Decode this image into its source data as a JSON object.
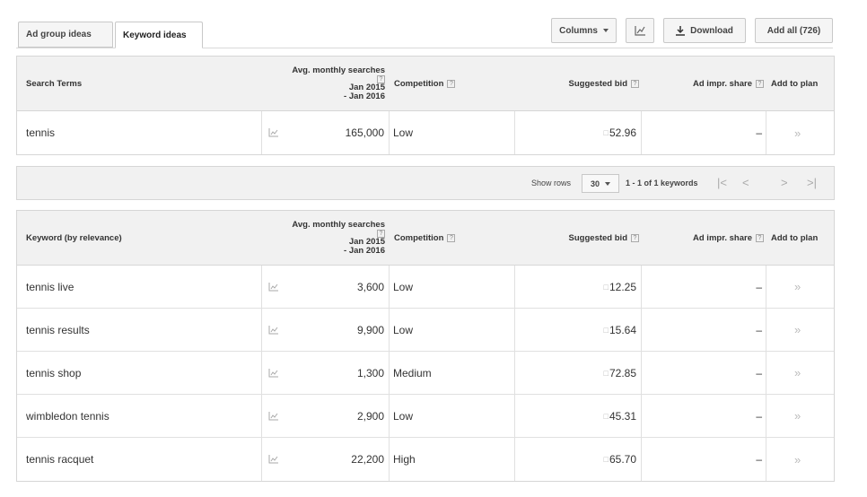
{
  "tabs": {
    "ad_group_ideas": "Ad group ideas",
    "keyword_ideas": "Keyword ideas"
  },
  "toolbar": {
    "columns_label": "Columns",
    "download_label": "Download",
    "add_all_label": "Add all (726)"
  },
  "search_terms_table": {
    "headers": {
      "term": "Search Terms",
      "searches_line1": "Avg. monthly searches",
      "searches_line2": "Jan 2015",
      "searches_line3": "- Jan 2016",
      "competition": "Competition",
      "bid": "Suggested bid",
      "impr_share": "Ad impr. share",
      "add_to_plan": "Add to plan"
    },
    "rows": [
      {
        "term": "tennis",
        "searches": "165,000",
        "competition": "Low",
        "bid": "52.96",
        "impr_share": "–",
        "add": "»"
      }
    ]
  },
  "pager": {
    "show_rows_label": "Show rows",
    "rows_value": "30",
    "range_text": "1 - 1 of 1 keywords",
    "first": "|<",
    "prev": "<",
    "next": ">",
    "last": ">|"
  },
  "keyword_table": {
    "headers": {
      "term": "Keyword (by relevance)",
      "searches_line1": "Avg. monthly searches",
      "searches_line2": "Jan 2015",
      "searches_line3": "- Jan 2016",
      "competition": "Competition",
      "bid": "Suggested bid",
      "impr_share": "Ad impr. share",
      "add_to_plan": "Add to plan"
    },
    "rows": [
      {
        "term": "tennis live",
        "searches": "3,600",
        "competition": "Low",
        "bid": "12.25",
        "impr_share": "–",
        "add": "»"
      },
      {
        "term": "tennis results",
        "searches": "9,900",
        "competition": "Low",
        "bid": "15.64",
        "impr_share": "–",
        "add": "»"
      },
      {
        "term": "tennis shop",
        "searches": "1,300",
        "competition": "Medium",
        "bid": "72.85",
        "impr_share": "–",
        "add": "»"
      },
      {
        "term": "wimbledon tennis",
        "searches": "2,900",
        "competition": "Low",
        "bid": "45.31",
        "impr_share": "–",
        "add": "»"
      },
      {
        "term": "tennis racquet",
        "searches": "22,200",
        "competition": "High",
        "bid": "65.70",
        "impr_share": "–",
        "add": "»"
      }
    ]
  },
  "icons": {
    "trend": "line-chart-icon",
    "download": "download-icon",
    "help": "help-icon",
    "add": "double-chevron-right-icon"
  }
}
